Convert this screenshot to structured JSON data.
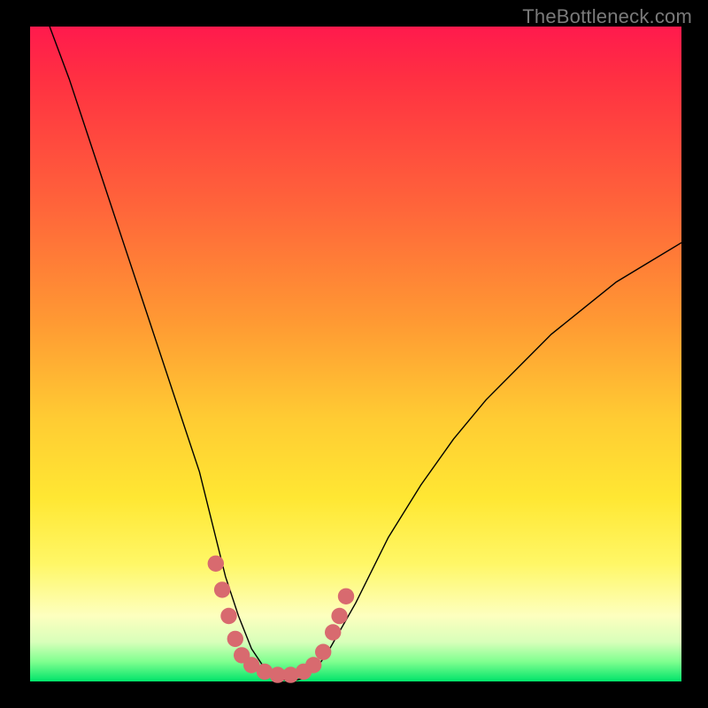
{
  "watermark": "TheBottleneck.com",
  "colors": {
    "curve": "#000000",
    "dot": "#d86a6f",
    "frame": "#000000"
  },
  "chart_data": {
    "type": "line",
    "title": "",
    "xlabel": "",
    "ylabel": "",
    "xlim": [
      0,
      100
    ],
    "ylim": [
      0,
      100
    ],
    "note": "Axes are unlabeled in the source image; x and y expressed as 0–100 percent of plot width/height. y = bottleneck severity (0 at bottom/green = no bottleneck, 100 at top/red = severe).",
    "series": [
      {
        "name": "bottleneck-curve",
        "x": [
          3,
          6,
          10,
          14,
          18,
          22,
          26,
          28,
          30,
          32,
          34,
          36,
          38,
          40,
          42,
          44,
          46,
          50,
          55,
          60,
          65,
          70,
          75,
          80,
          85,
          90,
          95,
          100
        ],
        "y": [
          100,
          92,
          80,
          68,
          56,
          44,
          32,
          24,
          16,
          10,
          5,
          2,
          0.5,
          0,
          0.5,
          2,
          5,
          12,
          22,
          30,
          37,
          43,
          48,
          53,
          57,
          61,
          64,
          67
        ]
      }
    ],
    "markers": {
      "name": "highlight-dots",
      "note": "Salmon dots clustered near the curve minimum.",
      "points": [
        {
          "x": 28.5,
          "y": 18
        },
        {
          "x": 29.5,
          "y": 14
        },
        {
          "x": 30.5,
          "y": 10
        },
        {
          "x": 31.5,
          "y": 6.5
        },
        {
          "x": 32.5,
          "y": 4
        },
        {
          "x": 34,
          "y": 2.5
        },
        {
          "x": 36,
          "y": 1.5
        },
        {
          "x": 38,
          "y": 1
        },
        {
          "x": 40,
          "y": 1
        },
        {
          "x": 42,
          "y": 1.5
        },
        {
          "x": 43.5,
          "y": 2.5
        },
        {
          "x": 45,
          "y": 4.5
        },
        {
          "x": 46.5,
          "y": 7.5
        },
        {
          "x": 47.5,
          "y": 10
        },
        {
          "x": 48.5,
          "y": 13
        }
      ]
    },
    "gradient_scale": {
      "description": "Background vertical gradient mapping y-value to severity color",
      "stops": [
        {
          "y": 100,
          "color": "#ff1a4d"
        },
        {
          "y": 55,
          "color": "#ff9933"
        },
        {
          "y": 28,
          "color": "#ffe733"
        },
        {
          "y": 8,
          "color": "#fdffbf"
        },
        {
          "y": 0,
          "color": "#00e46a"
        }
      ]
    }
  }
}
